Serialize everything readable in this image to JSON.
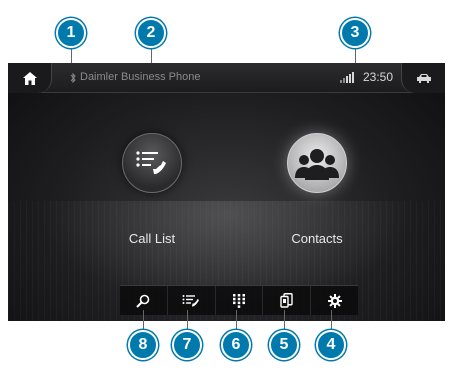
{
  "status_bar": {
    "bluetooth_icon": "bluetooth-icon",
    "phone_name": "Daimler Business Phone",
    "signal_icon": "signal-strength-icon",
    "time": "23:50",
    "home_icon": "home-icon",
    "car_icon": "car-icon"
  },
  "functions": [
    {
      "label": "Call List",
      "icon": "call-list-icon"
    },
    {
      "label": "Contacts",
      "icon": "contacts-icon"
    }
  ],
  "toolbar": {
    "items": [
      {
        "icon": "search-icon"
      },
      {
        "icon": "call-list-icon"
      },
      {
        "icon": "keypad-icon"
      },
      {
        "icon": "phone-devices-icon"
      },
      {
        "icon": "settings-gear-icon"
      }
    ]
  },
  "callouts": [
    "1",
    "2",
    "3",
    "4",
    "5",
    "6",
    "7",
    "8"
  ],
  "colors": {
    "callout_blue": "#0079ad",
    "screen_dark": "#1e1e20",
    "text_light": "#e8e8ea",
    "status_text": "#8a8a8e"
  }
}
